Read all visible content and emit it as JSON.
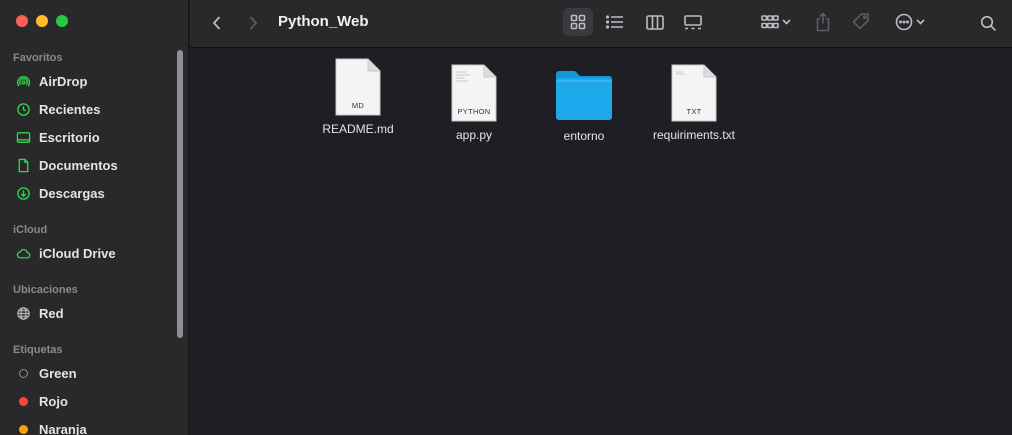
{
  "window": {
    "title": "Python_Web"
  },
  "sidebar": {
    "favorites_title": "Favoritos",
    "favorites": [
      {
        "label": "AirDrop",
        "icon": "airdrop-icon"
      },
      {
        "label": "Recientes",
        "icon": "clock-icon"
      },
      {
        "label": "Escritorio",
        "icon": "desktop-icon"
      },
      {
        "label": "Documentos",
        "icon": "document-icon"
      },
      {
        "label": "Descargas",
        "icon": "download-icon"
      }
    ],
    "icloud_title": "iCloud",
    "icloud": [
      {
        "label": "iCloud Drive",
        "icon": "cloud-icon"
      }
    ],
    "locations_title": "Ubicaciones",
    "locations": [
      {
        "label": "Red",
        "icon": "globe-icon"
      }
    ],
    "tags_title": "Etiquetas",
    "tags": [
      {
        "label": "Green",
        "color": "#8e8e93",
        "hollow": true
      },
      {
        "label": "Rojo",
        "color": "#ff453a",
        "hollow": false
      },
      {
        "label": "Naranja",
        "color": "#ff9f0a",
        "hollow": false
      }
    ],
    "accent_color": "#32d74b"
  },
  "files": [
    {
      "name": "README.md",
      "kind": "document",
      "ext": "MD"
    },
    {
      "name": "app.py",
      "kind": "document",
      "ext": "PYTHON"
    },
    {
      "name": "entorno",
      "kind": "folder",
      "ext": ""
    },
    {
      "name": "requiriments.txt",
      "kind": "document",
      "ext": "TXT"
    }
  ],
  "colors": {
    "folder": "#1ea8ec",
    "folder_tab": "#1596d8"
  }
}
